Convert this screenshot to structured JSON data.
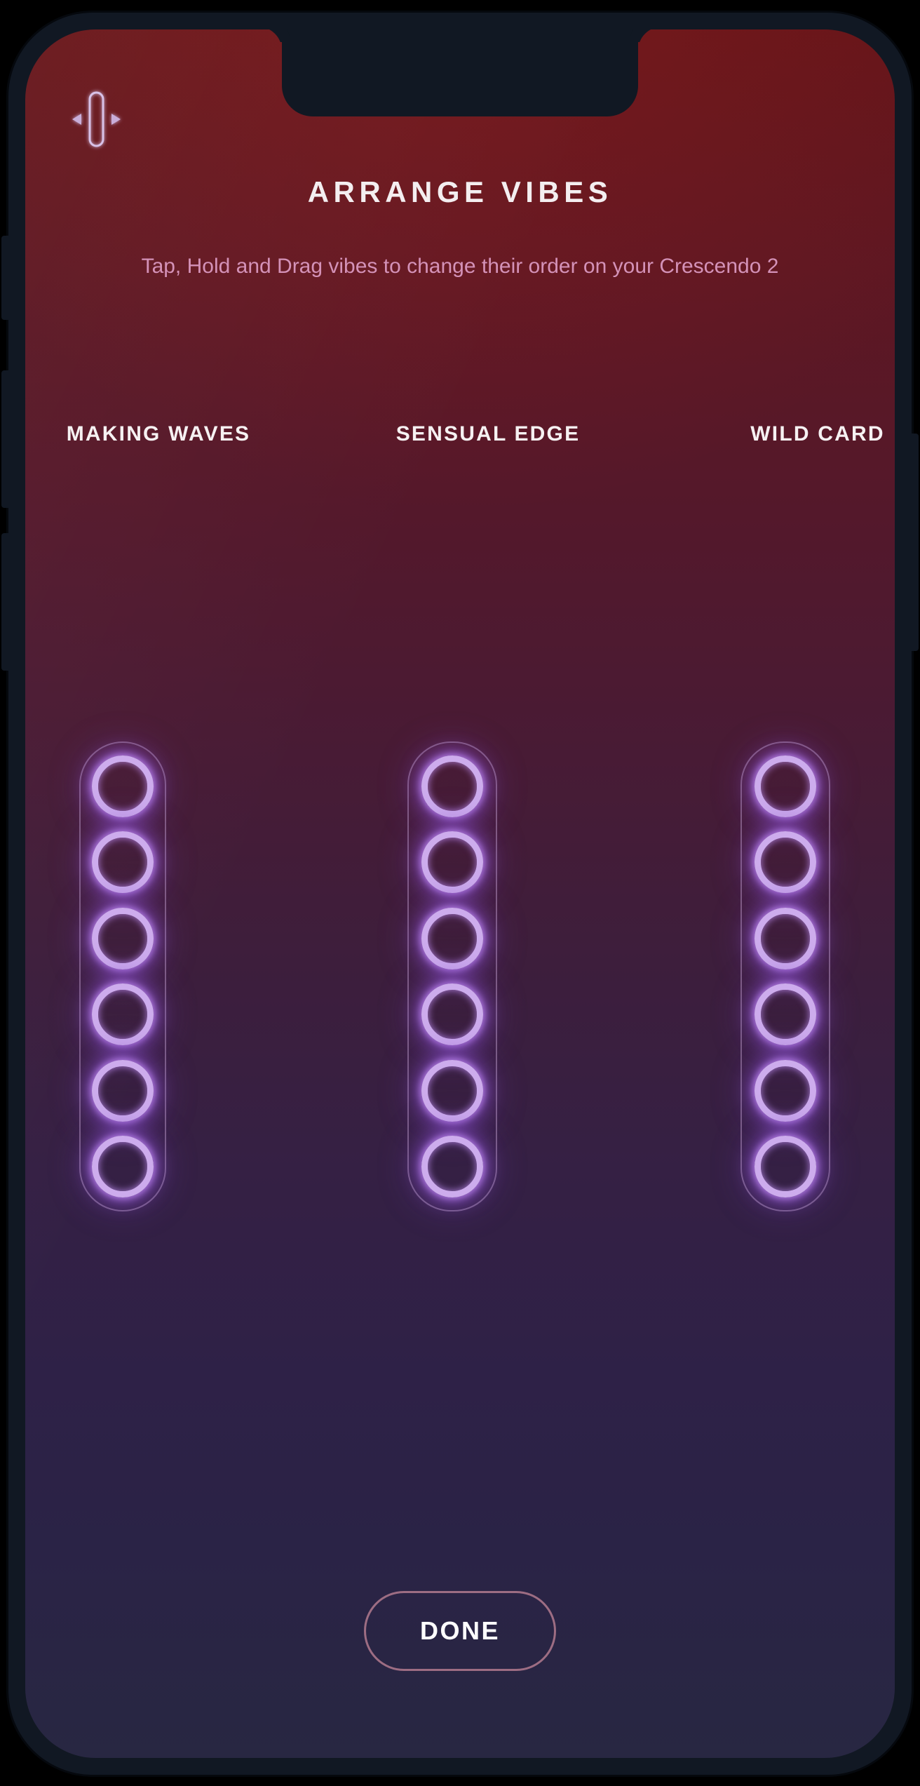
{
  "device": {
    "frame_color": "#111823",
    "screen_radius_px": 100,
    "side_buttons": [
      "mute-switch",
      "volume-up",
      "volume-down",
      "power"
    ]
  },
  "screen": {
    "gradient_top": "#651519",
    "gradient_mid": "#3d1e3c",
    "gradient_bottom": "#282742",
    "accent_neon": "#cdaced",
    "accent_glow": "#b67ee8",
    "subtitle_color": "#d492b8",
    "button_border_color": "#9d6d83"
  },
  "header": {
    "nav_icon": "vibe-device-reorder-icon",
    "title": "ARRANGE VIBES",
    "subtitle": "Tap, Hold and Drag vibes to change their order on your Crescendo 2"
  },
  "columns": [
    {
      "label": "MAKING WAVES",
      "ring_count": 6,
      "rings": [
        "vibe-slot-1",
        "vibe-slot-2",
        "vibe-slot-3",
        "vibe-slot-4",
        "vibe-slot-5",
        "vibe-slot-6"
      ]
    },
    {
      "label": "SENSUAL EDGE",
      "ring_count": 6,
      "rings": [
        "vibe-slot-1",
        "vibe-slot-2",
        "vibe-slot-3",
        "vibe-slot-4",
        "vibe-slot-5",
        "vibe-slot-6"
      ]
    },
    {
      "label": "WILD CARD",
      "ring_count": 6,
      "rings": [
        "vibe-slot-1",
        "vibe-slot-2",
        "vibe-slot-3",
        "vibe-slot-4",
        "vibe-slot-5",
        "vibe-slot-6"
      ]
    }
  ],
  "footer": {
    "done_label": "DONE"
  }
}
